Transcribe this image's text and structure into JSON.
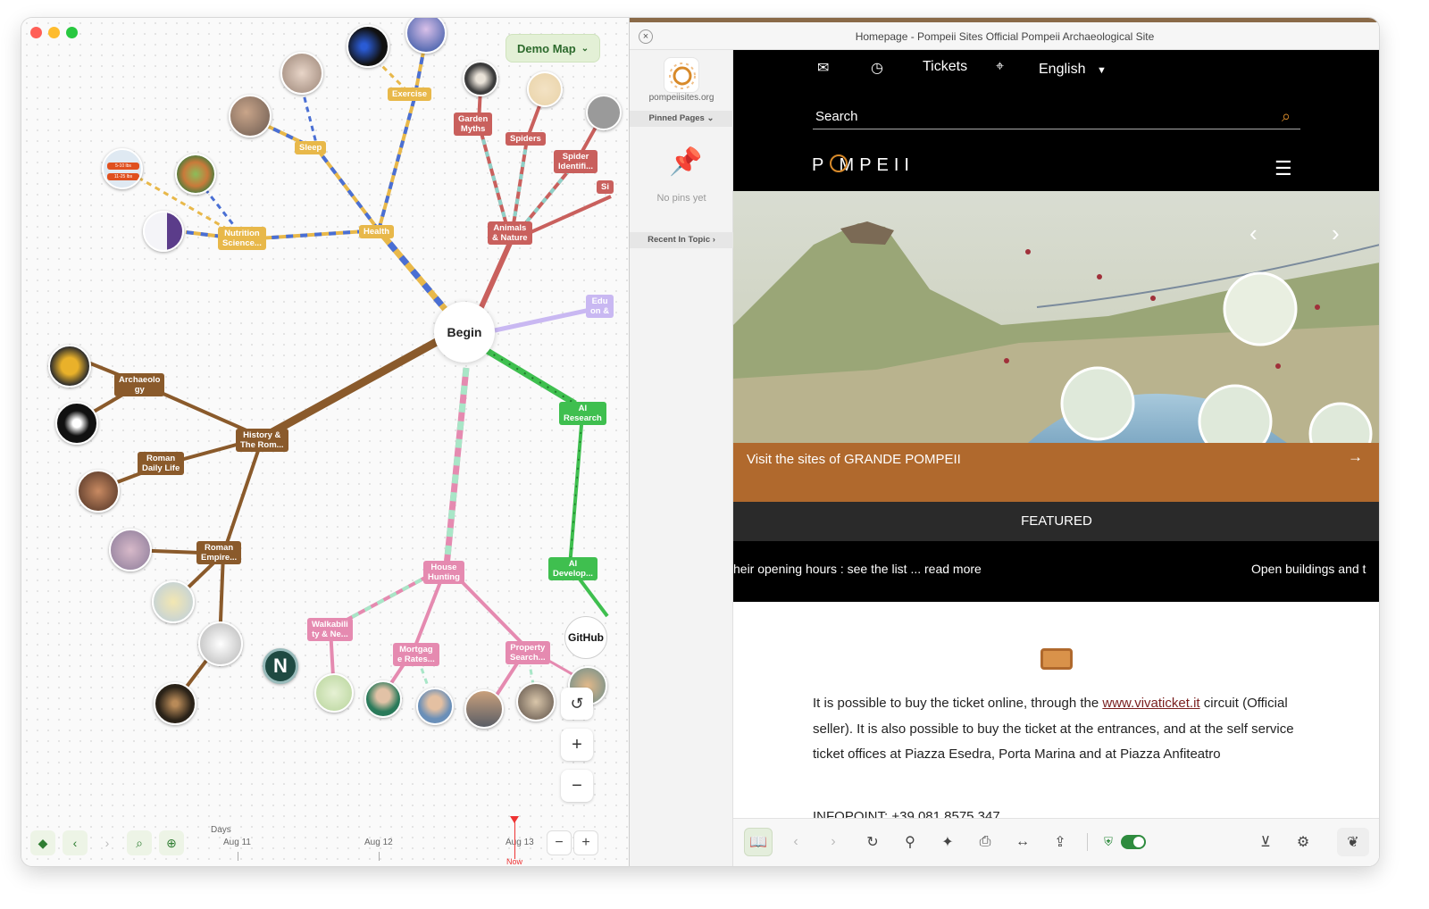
{
  "map": {
    "demo_map_label": "Demo Map",
    "center_label": "Begin",
    "nodes": {
      "exercise": "Exercise",
      "sleep": "Sleep",
      "garden_myths": "Garden\nMyths",
      "spiders": "Spiders",
      "spider_id": "Spider\nIdentifi...",
      "si": "Si",
      "animals_nature": "Animals\n& Nature",
      "health": "Health",
      "nutrition": "Nutrition\nScience...",
      "education": "Edu\non &",
      "archaeology": "Archaeolo\ngy",
      "history_rome": "History &\nThe Rom...",
      "roman_daily": "Roman\nDaily Life",
      "roman_empire": "Roman\nEmpire...",
      "ai_research": "AI\nResearch",
      "ai_develop": "AI\nDevelop...",
      "house_hunting": "House\nHunting",
      "walkability": "Walkabili\nty & Ne...",
      "mortgage": "Mortgag\ne Rates...",
      "property_search": "Property\nSearch..."
    },
    "github_label": "GitHub",
    "timeline": {
      "days_label": "Days",
      "dates": [
        "Aug 11",
        "Aug 12",
        "Aug 13"
      ],
      "now_label": "Now"
    },
    "zoom": {
      "plus": "+",
      "minus": "−"
    },
    "thumb_badges": [
      "5-10 lbs",
      "11-25 lbs"
    ]
  },
  "browser": {
    "page_title": "Homepage - Pompeii Sites Official Pompeii Archaeological Site",
    "sidebar": {
      "domain": "pompeiisites.org",
      "pinned_pages": "Pinned Pages",
      "no_pins": "No pins yet",
      "recent_in_topic": "Recent In Topic"
    },
    "site": {
      "nav_tickets": "Tickets",
      "nav_language": "English",
      "search_placeholder": "Search",
      "logo_text": "P  MPEII",
      "visit_banner": "Visit the sites of GRANDE POMPEII",
      "featured": "FEATURED",
      "ticker_left": "heir opening hours : see the list ... read more",
      "ticker_right": "Open buildings and t",
      "body_before_link": "It is possible to buy the ticket online, through the ",
      "body_link": "www.vivaticket.it",
      "body_after_link": " circuit (Official seller).  It is also possible to buy the ticket at the entrances, and at the self service ticket offices at Piazza Esedra, Porta Marina and at Piazza Anfiteatro",
      "cut_line": "INFOPOINT: +39 081 8575 347"
    }
  },
  "colors": {
    "history": "#8a5a2b",
    "health": "#e8b84a",
    "animals": "#c9605d",
    "ai": "#3fbf4f",
    "house": "#e58ab0",
    "orange_bar": "#b0692d",
    "toggle": "#2e8b3e"
  }
}
